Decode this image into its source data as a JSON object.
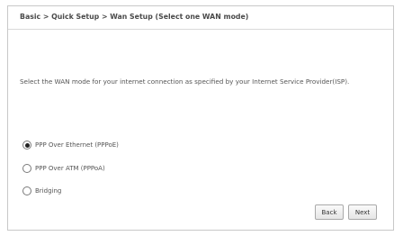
{
  "breadcrumb": "Basic > Quick Setup > Wan Setup (Select one WAN mode)",
  "instruction": "Select the WAN mode for your internet connection as specified by your Internet Service Provider(ISP).",
  "wan_modes": [
    {
      "label": "PPP Over Ethernet (PPPoE)",
      "checked": true
    },
    {
      "label": "PPP Over ATM (PPPoA)",
      "checked": false
    },
    {
      "label": "Bridging",
      "checked": false
    }
  ],
  "buttons": {
    "back": "Back",
    "next": "Next"
  }
}
